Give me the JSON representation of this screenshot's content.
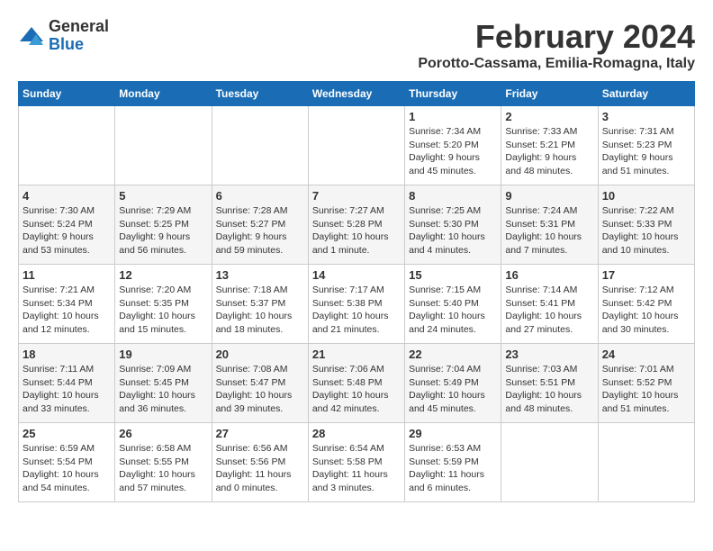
{
  "logo": {
    "text_general": "General",
    "text_blue": "Blue"
  },
  "header": {
    "month": "February 2024",
    "location": "Porotto-Cassama, Emilia-Romagna, Italy"
  },
  "weekdays": [
    "Sunday",
    "Monday",
    "Tuesday",
    "Wednesday",
    "Thursday",
    "Friday",
    "Saturday"
  ],
  "weeks": [
    [
      {
        "day": "",
        "info": ""
      },
      {
        "day": "",
        "info": ""
      },
      {
        "day": "",
        "info": ""
      },
      {
        "day": "",
        "info": ""
      },
      {
        "day": "1",
        "info": "Sunrise: 7:34 AM\nSunset: 5:20 PM\nDaylight: 9 hours\nand 45 minutes."
      },
      {
        "day": "2",
        "info": "Sunrise: 7:33 AM\nSunset: 5:21 PM\nDaylight: 9 hours\nand 48 minutes."
      },
      {
        "day": "3",
        "info": "Sunrise: 7:31 AM\nSunset: 5:23 PM\nDaylight: 9 hours\nand 51 minutes."
      }
    ],
    [
      {
        "day": "4",
        "info": "Sunrise: 7:30 AM\nSunset: 5:24 PM\nDaylight: 9 hours\nand 53 minutes."
      },
      {
        "day": "5",
        "info": "Sunrise: 7:29 AM\nSunset: 5:25 PM\nDaylight: 9 hours\nand 56 minutes."
      },
      {
        "day": "6",
        "info": "Sunrise: 7:28 AM\nSunset: 5:27 PM\nDaylight: 9 hours\nand 59 minutes."
      },
      {
        "day": "7",
        "info": "Sunrise: 7:27 AM\nSunset: 5:28 PM\nDaylight: 10 hours\nand 1 minute."
      },
      {
        "day": "8",
        "info": "Sunrise: 7:25 AM\nSunset: 5:30 PM\nDaylight: 10 hours\nand 4 minutes."
      },
      {
        "day": "9",
        "info": "Sunrise: 7:24 AM\nSunset: 5:31 PM\nDaylight: 10 hours\nand 7 minutes."
      },
      {
        "day": "10",
        "info": "Sunrise: 7:22 AM\nSunset: 5:33 PM\nDaylight: 10 hours\nand 10 minutes."
      }
    ],
    [
      {
        "day": "11",
        "info": "Sunrise: 7:21 AM\nSunset: 5:34 PM\nDaylight: 10 hours\nand 12 minutes."
      },
      {
        "day": "12",
        "info": "Sunrise: 7:20 AM\nSunset: 5:35 PM\nDaylight: 10 hours\nand 15 minutes."
      },
      {
        "day": "13",
        "info": "Sunrise: 7:18 AM\nSunset: 5:37 PM\nDaylight: 10 hours\nand 18 minutes."
      },
      {
        "day": "14",
        "info": "Sunrise: 7:17 AM\nSunset: 5:38 PM\nDaylight: 10 hours\nand 21 minutes."
      },
      {
        "day": "15",
        "info": "Sunrise: 7:15 AM\nSunset: 5:40 PM\nDaylight: 10 hours\nand 24 minutes."
      },
      {
        "day": "16",
        "info": "Sunrise: 7:14 AM\nSunset: 5:41 PM\nDaylight: 10 hours\nand 27 minutes."
      },
      {
        "day": "17",
        "info": "Sunrise: 7:12 AM\nSunset: 5:42 PM\nDaylight: 10 hours\nand 30 minutes."
      }
    ],
    [
      {
        "day": "18",
        "info": "Sunrise: 7:11 AM\nSunset: 5:44 PM\nDaylight: 10 hours\nand 33 minutes."
      },
      {
        "day": "19",
        "info": "Sunrise: 7:09 AM\nSunset: 5:45 PM\nDaylight: 10 hours\nand 36 minutes."
      },
      {
        "day": "20",
        "info": "Sunrise: 7:08 AM\nSunset: 5:47 PM\nDaylight: 10 hours\nand 39 minutes."
      },
      {
        "day": "21",
        "info": "Sunrise: 7:06 AM\nSunset: 5:48 PM\nDaylight: 10 hours\nand 42 minutes."
      },
      {
        "day": "22",
        "info": "Sunrise: 7:04 AM\nSunset: 5:49 PM\nDaylight: 10 hours\nand 45 minutes."
      },
      {
        "day": "23",
        "info": "Sunrise: 7:03 AM\nSunset: 5:51 PM\nDaylight: 10 hours\nand 48 minutes."
      },
      {
        "day": "24",
        "info": "Sunrise: 7:01 AM\nSunset: 5:52 PM\nDaylight: 10 hours\nand 51 minutes."
      }
    ],
    [
      {
        "day": "25",
        "info": "Sunrise: 6:59 AM\nSunset: 5:54 PM\nDaylight: 10 hours\nand 54 minutes."
      },
      {
        "day": "26",
        "info": "Sunrise: 6:58 AM\nSunset: 5:55 PM\nDaylight: 10 hours\nand 57 minutes."
      },
      {
        "day": "27",
        "info": "Sunrise: 6:56 AM\nSunset: 5:56 PM\nDaylight: 11 hours\nand 0 minutes."
      },
      {
        "day": "28",
        "info": "Sunrise: 6:54 AM\nSunset: 5:58 PM\nDaylight: 11 hours\nand 3 minutes."
      },
      {
        "day": "29",
        "info": "Sunrise: 6:53 AM\nSunset: 5:59 PM\nDaylight: 11 hours\nand 6 minutes."
      },
      {
        "day": "",
        "info": ""
      },
      {
        "day": "",
        "info": ""
      }
    ]
  ]
}
